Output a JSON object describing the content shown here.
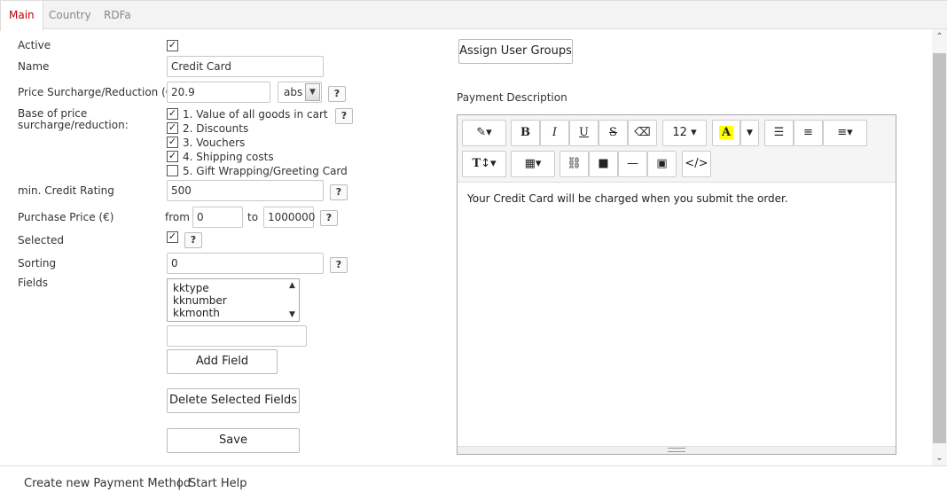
{
  "tabs": [
    {
      "label": "Main"
    },
    {
      "label": "Country"
    },
    {
      "label": "RDFa"
    }
  ],
  "form": {
    "active_label": "Active",
    "name_label": "Name",
    "name_value": "Credit Card",
    "surcharge_label": "Price Surcharge/Reduction (€)",
    "surcharge_value": "20.9",
    "surcharge_type": "abs",
    "base_label_1": "Base of price",
    "base_label_2": "surcharge/reduction:",
    "base_options": [
      {
        "label": "1. Value of all goods in cart",
        "checked": true
      },
      {
        "label": "2. Discounts",
        "checked": true
      },
      {
        "label": "3. Vouchers",
        "checked": true
      },
      {
        "label": "4. Shipping costs",
        "checked": true
      },
      {
        "label": "5. Gift Wrapping/Greeting Card",
        "checked": false
      }
    ],
    "credit_label": "min. Credit Rating",
    "credit_value": "500",
    "purchase_label": "Purchase Price (€)",
    "from_label": "from",
    "from_value": "0",
    "to_label": "to",
    "to_value": "1000000",
    "selected_label": "Selected",
    "sorting_label": "Sorting",
    "sorting_value": "0",
    "fields_label": "Fields",
    "fields_options": [
      "kktype",
      "kknumber",
      "kkmonth"
    ],
    "new_field_value": "",
    "add_field_label": "Add Field",
    "delete_fields_label": "Delete Selected Fields",
    "save_label": "Save",
    "help_glyph": "?"
  },
  "right": {
    "assign_groups_label": "Assign User Groups",
    "description_label": "Payment Description",
    "font_size": "12",
    "editor_text": "Your Credit Card will be charged when you submit the order."
  },
  "footer": {
    "create_label": "Create new Payment Method",
    "separator": "|",
    "help_label": "Start Help"
  }
}
